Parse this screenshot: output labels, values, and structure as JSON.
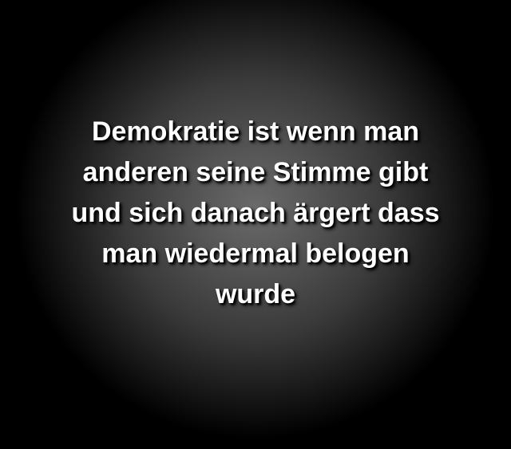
{
  "quote": {
    "lines": [
      "Demokratie ist wenn man",
      "anderen seine Stimme gibt",
      "und sich danach ärgert dass",
      "man wiedermal belogen",
      "wurde"
    ]
  }
}
